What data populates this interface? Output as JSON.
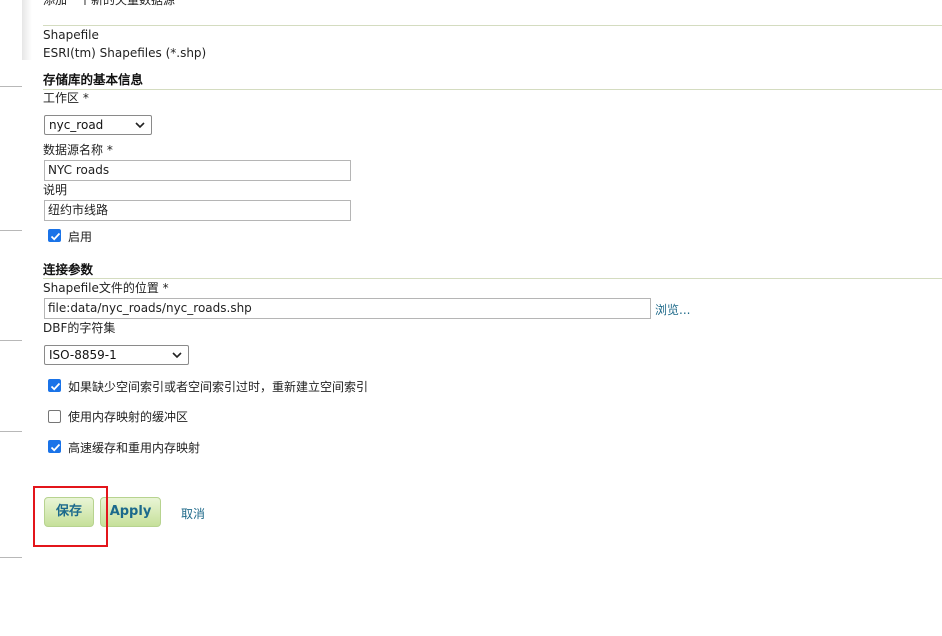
{
  "form": {
    "header_text": "添加一个新的矢量数据源",
    "source_type": "Shapefile",
    "source_description": "ESRI(tm) Shapefiles (*.shp)"
  },
  "basic_info": {
    "title": "存储库的基本信息",
    "workspace_label": "工作区 *",
    "workspace_value": "nyc_road",
    "datasource_name_label": "数据源名称 *",
    "datasource_name_value": "NYC roads",
    "description_label": "说明",
    "description_value": "纽约市线路",
    "enabled_label": "启用",
    "enabled_checked": true
  },
  "connection": {
    "title": "连接参数",
    "shapefile_location_label": "Shapefile文件的位置 *",
    "shapefile_location_value": "file:data/nyc_roads/nyc_roads.shp",
    "browse_label": "浏览...",
    "dbf_charset_label": "DBF的字符集",
    "dbf_charset_value": "ISO-8859-1",
    "options": [
      {
        "label": "如果缺少空间索引或者空间索引过时，重新建立空间索引",
        "checked": true
      },
      {
        "label": "使用内存映射的缓冲区",
        "checked": false
      },
      {
        "label": "高速缓存和重用内存映射",
        "checked": true
      }
    ]
  },
  "actions": {
    "save_label": "保存",
    "apply_label": "Apply",
    "cancel_label": "取消"
  },
  "colors": {
    "checkbox_checked": "#1a73e8",
    "button_gradient_top": "#e9f5d6",
    "button_gradient_bottom": "#c6e09a",
    "button_text": "#1c6a8c",
    "link": "#1f6a8a",
    "highlight": "#e3151b",
    "rule": "#d4dcc0"
  },
  "icons": {
    "select_arrow": "chevron-down-icon",
    "checkmark": "check-icon"
  }
}
